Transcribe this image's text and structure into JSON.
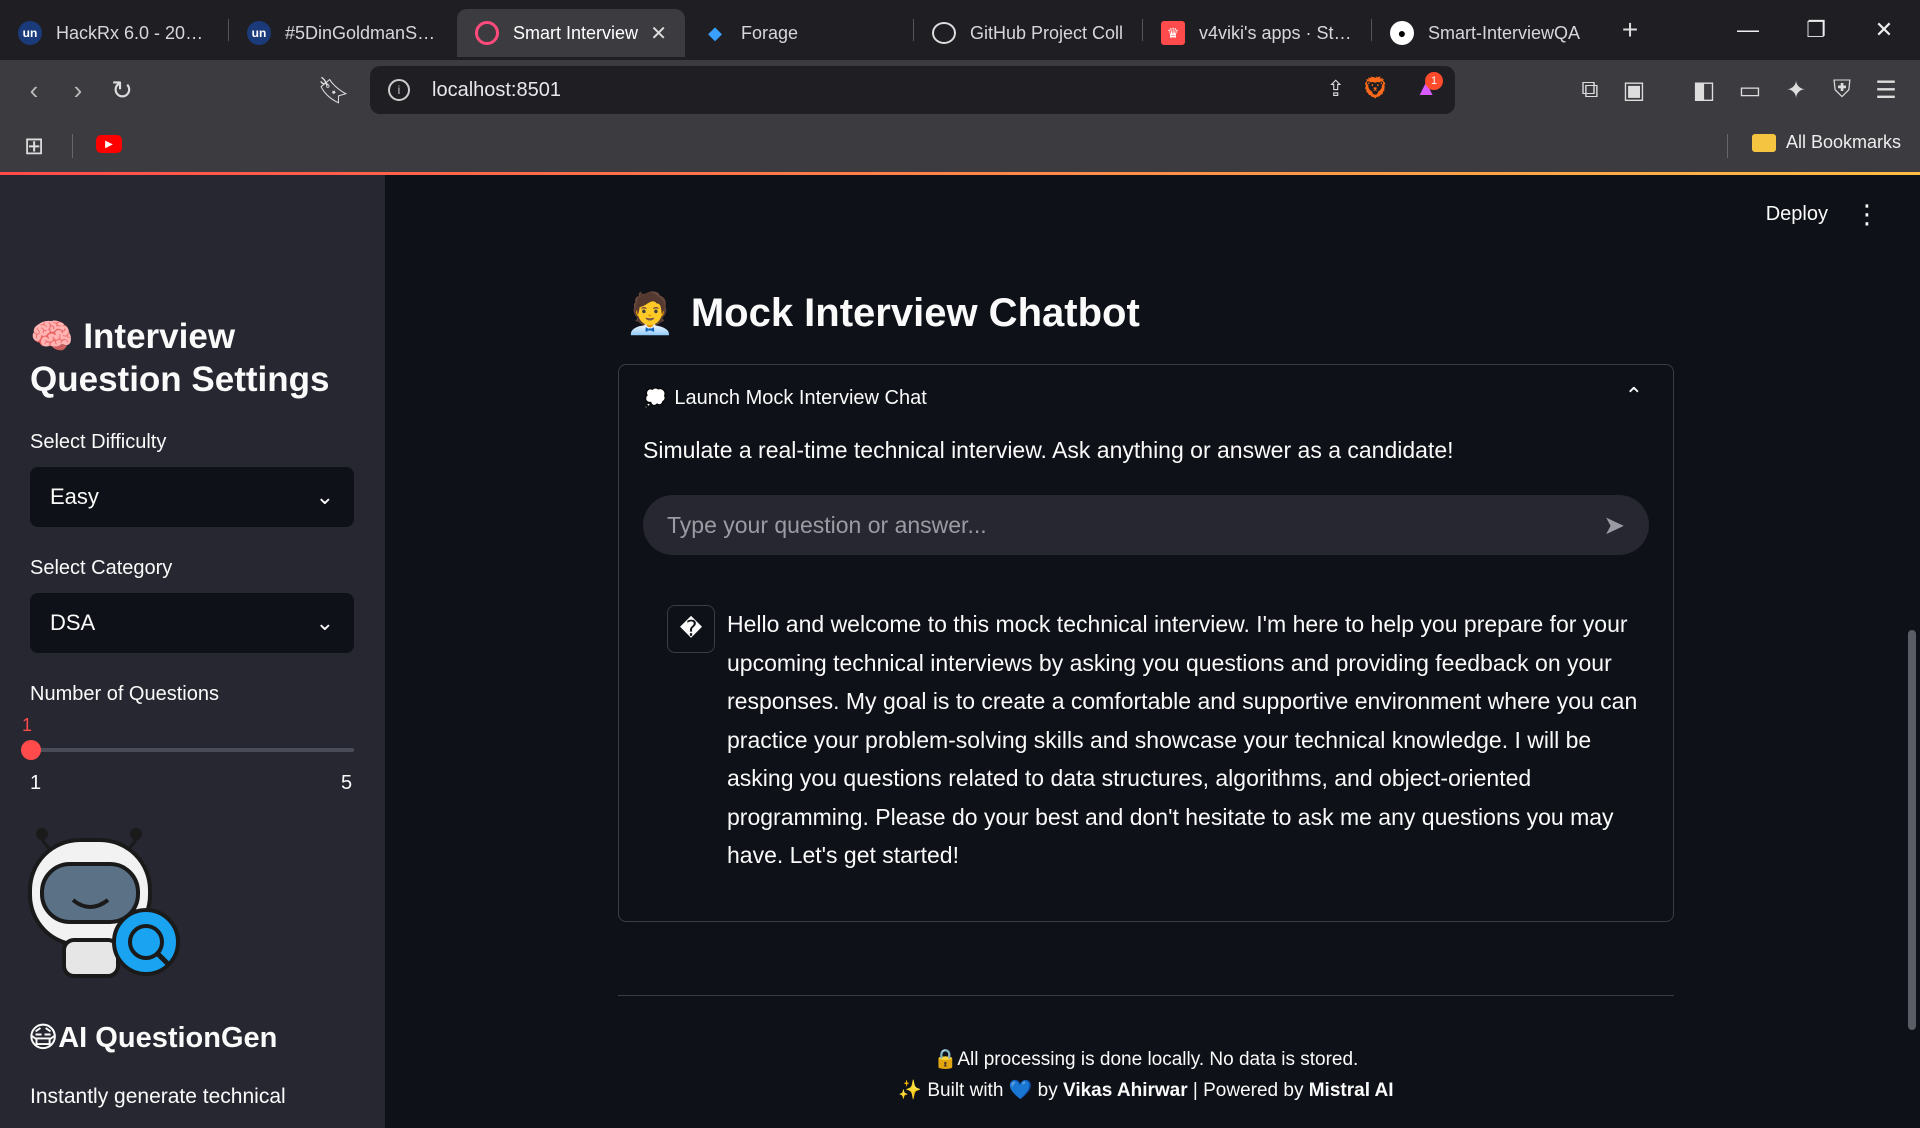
{
  "browser": {
    "tabs": [
      {
        "label": "HackRx 6.0 - 2025 |",
        "icon": "unstop-icon",
        "active": false
      },
      {
        "label": "#5DinGoldmanSachs",
        "icon": "unstop-icon",
        "active": false
      },
      {
        "label": "Smart Interview",
        "icon": "streamlit-icon",
        "active": true
      },
      {
        "label": "Forage",
        "icon": "forage-icon",
        "active": false
      },
      {
        "label": "GitHub Project Coll",
        "icon": "openai-icon",
        "active": false
      },
      {
        "label": "v4viki's apps · Strea",
        "icon": "streamlit-crown-icon",
        "active": false
      },
      {
        "label": "Smart-InterviewQA",
        "icon": "github-icon",
        "active": false
      }
    ],
    "url": "localhost:8501",
    "bookmarks_label": "All Bookmarks",
    "notification_count": "1"
  },
  "sidebar": {
    "title_emoji": "🧠",
    "title": "Interview Question Settings",
    "difficulty_label": "Select Difficulty",
    "difficulty_value": "Easy",
    "category_label": "Select Category",
    "category_value": "DSA",
    "questions_label": "Number of Questions",
    "questions_value": "1",
    "questions_min": "1",
    "questions_max": "5",
    "app_emoji": "😷",
    "app_name": "AI QuestionGen",
    "app_desc": "Instantly generate technical"
  },
  "main": {
    "deploy_label": "Deploy",
    "page_emoji": "🧑‍💼",
    "page_title": "Mock Interview Chatbot",
    "expander_emoji": "💭",
    "expander_label": "Launch Mock Interview Chat",
    "expander_desc": "Simulate a real-time technical interview. Ask anything or answer as a candidate!",
    "chat_placeholder": "Type your question or answer...",
    "assistant_avatar": "�",
    "assistant_message": "Hello and welcome to this mock technical interview. I'm here to help you prepare for your upcoming technical interviews by asking you questions and providing feedback on your responses. My goal is to create a comfortable and supportive environment where you can practice your problem-solving skills and showcase your technical knowledge. I will be asking you questions related to data structures, algorithms, and object-oriented programming. Please do your best and don't hesitate to ask me any questions you may have. Let's get started!",
    "footer_line1": "🔒All processing is done locally. No data is stored.",
    "footer_built": "✨ Built with",
    "footer_heart": "💙",
    "footer_by": "by",
    "footer_author": "Vikas Ahirwar",
    "footer_powered": "| Powered by",
    "footer_ai": "Mistral AI"
  },
  "colors": {
    "accent": "#ff4b4b",
    "sidebar_bg": "#262730",
    "main_bg": "#0e1117"
  }
}
